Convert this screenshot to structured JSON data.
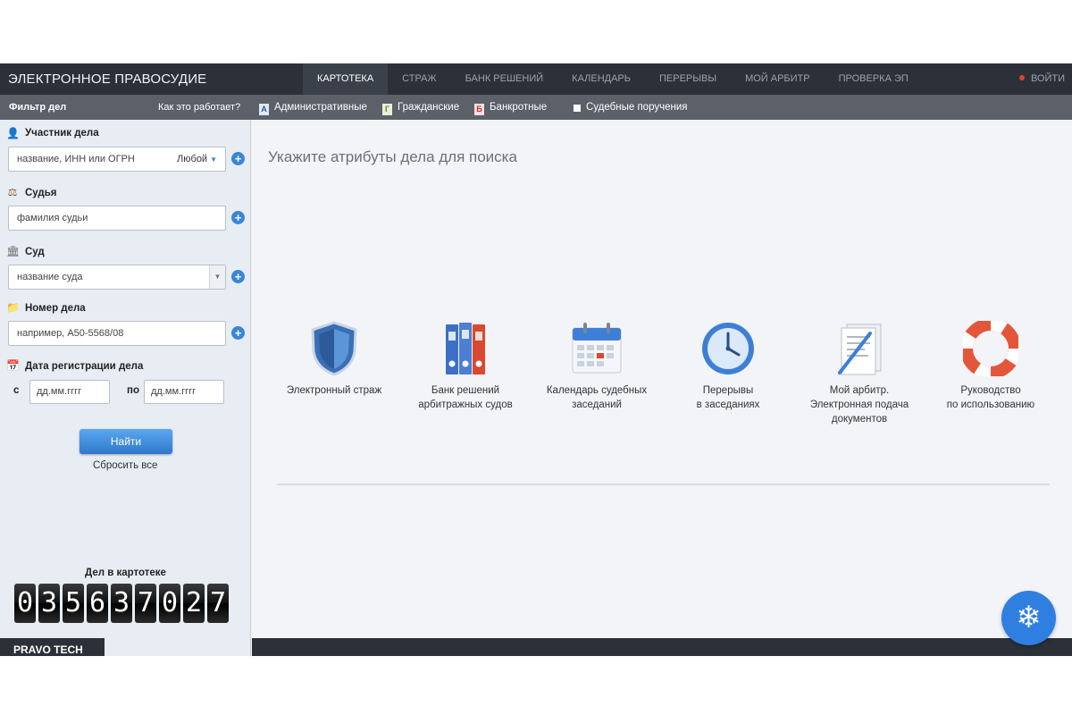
{
  "app": {
    "brand": "ЭЛЕКТРОННОЕ ПРАВОСУДИЕ",
    "nav": [
      {
        "label": "КАРТОТЕКА",
        "active": true
      },
      {
        "label": "СТРАЖ",
        "active": false
      },
      {
        "label": "БАНК РЕШЕНИЙ",
        "active": false
      },
      {
        "label": "КАЛЕНДАРЬ",
        "active": false
      },
      {
        "label": "ПЕРЕРЫВЫ",
        "active": false
      },
      {
        "label": "МОЙ АРБИТР",
        "active": false
      },
      {
        "label": "ПРОВЕРКА ЭП",
        "active": false
      }
    ],
    "login": "ВОЙТИ"
  },
  "subbar": {
    "filter_title": "Фильтр дел",
    "howto": "Как это работает?",
    "tabs": [
      {
        "icon": "А",
        "label": "Административные"
      },
      {
        "icon": "Г",
        "label": "Гражданские"
      },
      {
        "icon": "Б",
        "label": "Банкротные"
      },
      {
        "icon": "",
        "label": "Судебные поручения"
      }
    ]
  },
  "sidebar": {
    "participant": {
      "label": "Участник дела",
      "placeholder": "название, ИНН или ОГРН",
      "mode": "Любой"
    },
    "judge": {
      "label": "Судья",
      "placeholder": "фамилия судьи"
    },
    "court": {
      "label": "Суд",
      "placeholder": "название суда"
    },
    "case_number": {
      "label": "Номер дела",
      "placeholder": "например, А50-5568/08"
    },
    "reg_date": {
      "label": "Дата регистрации дела",
      "from_label": "с",
      "to_label": "по",
      "from_placeholder": "дд.мм.гггг",
      "to_placeholder": "дд.мм.гггг"
    },
    "find_button": "Найти",
    "reset": "Сбросить все",
    "counter_title": "Дел в картотеке",
    "counter_digits": [
      "0",
      "3",
      "5",
      "6",
      "3",
      "7",
      "0",
      "2",
      "7"
    ],
    "footer_brand": "PRAVO TECH"
  },
  "main": {
    "title": "Укажите атрибуты дела для поиска",
    "tiles": [
      {
        "icon": "shield-icon",
        "caption": "Электронный страж"
      },
      {
        "icon": "binders-icon",
        "caption": "Банк решений\nарбитражных судов"
      },
      {
        "icon": "calendar-icon",
        "caption": "Календарь судебных\nзаседаний"
      },
      {
        "icon": "clock-icon",
        "caption": "Перерывы\nв заседаниях"
      },
      {
        "icon": "document-icon",
        "caption": "Мой арбитр.\nЭлектронная подача\nдокументов"
      },
      {
        "icon": "lifebuoy-icon",
        "caption": "Руководство\nпо использованию"
      }
    ]
  },
  "emblem": {
    "icon": "eagle-emblem-icon"
  }
}
